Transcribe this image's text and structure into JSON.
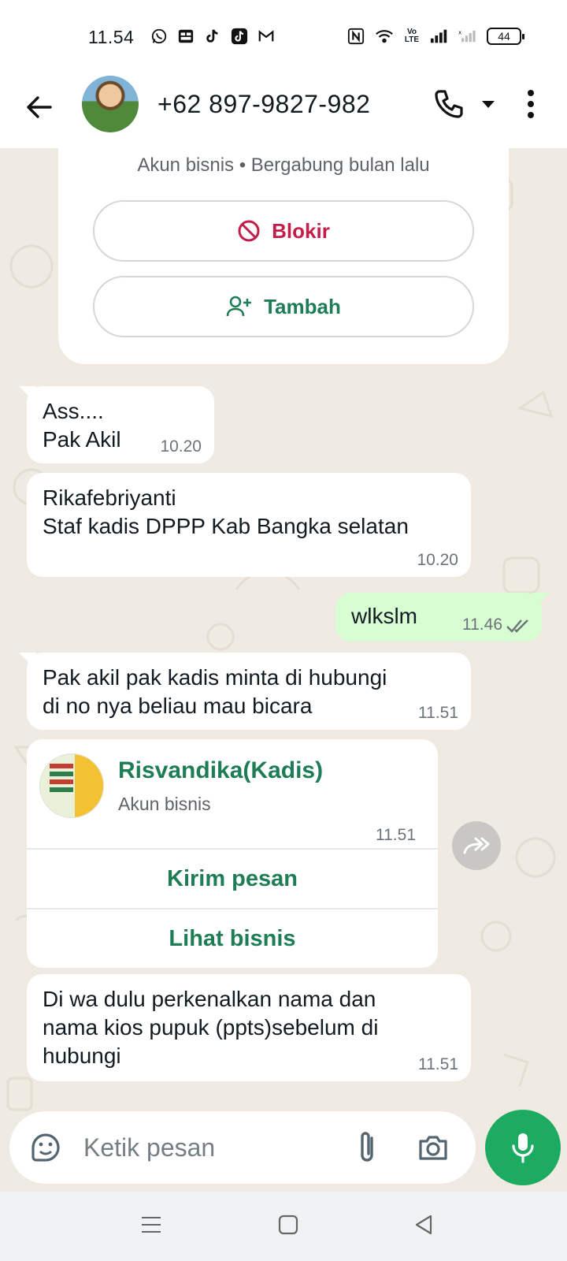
{
  "status_bar": {
    "time": "11.54",
    "battery": "44",
    "volte": "Vo LTE"
  },
  "header": {
    "contact": "+62 897-9827-982"
  },
  "business_card": {
    "subtitle": "Akun bisnis • Bergabung bulan lalu",
    "block_label": "Blokir",
    "add_label": "Tambah"
  },
  "messages": [
    {
      "direction": "in",
      "lines": [
        "Ass....",
        "Pak Akil"
      ],
      "time": "10.20"
    },
    {
      "direction": "in",
      "lines": [
        "Rikafebriyanti",
        "Staf kadis DPPP Kab Bangka selatan"
      ],
      "time": "10.20"
    },
    {
      "direction": "out",
      "lines": [
        "wlkslm"
      ],
      "time": "11.46",
      "status": "read"
    },
    {
      "direction": "in",
      "lines": [
        "Pak akil pak kadis minta di hubungi",
        "di no nya beliau mau bicara"
      ],
      "time": "11.51"
    },
    {
      "direction": "in",
      "lines": [
        "Di wa dulu perkenalkan nama dan",
        "nama kios pupuk (ppts)sebelum di",
        "hubungi"
      ],
      "time": "11.51"
    }
  ],
  "shared_contact": {
    "name": "Risvandika(Kadis)",
    "type": "Akun bisnis",
    "time": "11.51",
    "send_label": "Kirim pesan",
    "view_label": "Lihat bisnis"
  },
  "composer": {
    "placeholder": "Ketik pesan"
  },
  "colors": {
    "accent": "#1e7d55",
    "danger": "#c41d4b",
    "outgoing": "#d9fdd3",
    "mic": "#1daa61",
    "chat_bg": "#efeae2"
  }
}
